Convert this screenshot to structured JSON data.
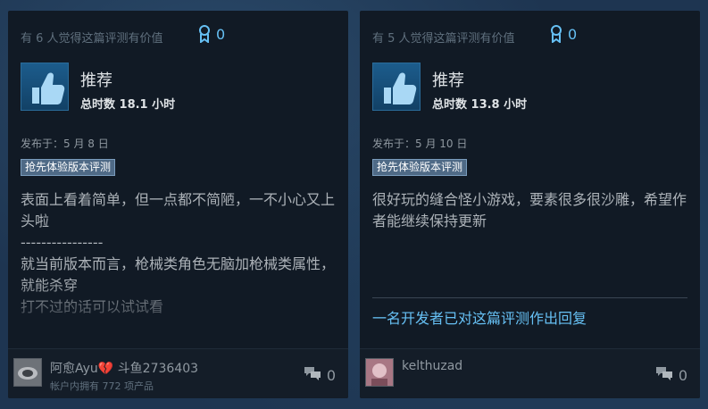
{
  "reviews": [
    {
      "helpful_text": "有 6 人觉得这篇评测有价值",
      "awards_count": "0",
      "recommendation": "推荐",
      "hours": "总时数 18.1 小时",
      "posted": "发布于：5 月 8 日",
      "early_access_tag": "抢先体验版本评测",
      "body": "表面上看着简单，但一点都不简陋，一不小心又上头啦\n----------------\n就当前版本而言，枪械类角色无脑加枪械类属性，就能杀穿\n打不过的话可以试试看",
      "author_name_1": "阿愈Ayu",
      "author_heart": "💔",
      "author_name_2": "斗鱼2736403",
      "products_owned": "帐户内拥有 772 项产品",
      "comment_count": "0"
    },
    {
      "helpful_text": "有 5 人觉得这篇评测有价值",
      "awards_count": "0",
      "recommendation": "推荐",
      "hours": "总时数 13.8 小时",
      "posted": "发布于：5 月 10 日",
      "early_access_tag": "抢先体验版本评测",
      "body": "很好玩的缝合怪小游戏，要素很多很沙雕，希望作者能继续保持更新",
      "developer_reply": "一名开发者已对这篇评测作出回复",
      "author_name": "kelthuzad",
      "comment_count": "0"
    }
  ],
  "icons": {
    "award": "award-ribbon-icon",
    "thumb": "thumbs-up-icon",
    "comment": "comment-bubbles-icon"
  },
  "colors": {
    "accent": "#66c0f4",
    "card_bg": "#111a25",
    "text_muted": "#8f98a0",
    "text_body": "#acb2b8"
  }
}
